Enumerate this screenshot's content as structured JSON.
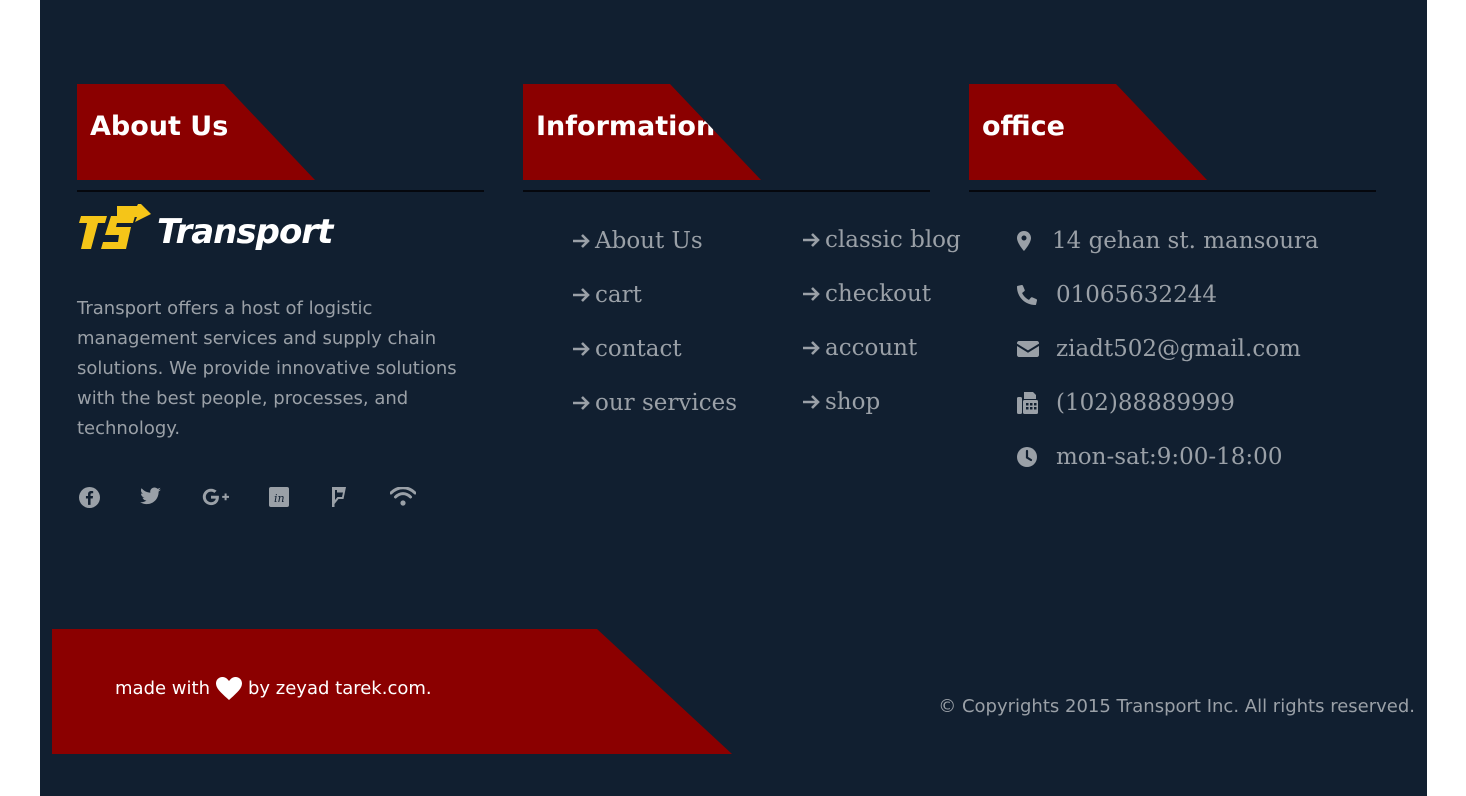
{
  "columns": {
    "about": {
      "title": "About Us"
    },
    "info": {
      "title": "Information"
    },
    "office": {
      "title": "office"
    }
  },
  "brand": {
    "name": "Transport",
    "logo_icon": "ts-arrow-logo",
    "accent": "#f5c518",
    "description": "Transport offers a host of logistic management services and supply chain solutions. We provide innovative solutions with the best people, processes, and technology."
  },
  "socials": [
    {
      "icon": "facebook-icon"
    },
    {
      "icon": "twitter-icon"
    },
    {
      "icon": "google-plus-icon"
    },
    {
      "icon": "linkedin-icon"
    },
    {
      "icon": "foursquare-icon"
    },
    {
      "icon": "rss-icon"
    }
  ],
  "links": {
    "left": [
      "About Us",
      "cart",
      "contact",
      "our services"
    ],
    "right": [
      "classic blog",
      "checkout",
      "account",
      "shop"
    ]
  },
  "office": {
    "address": "14 gehan st. mansoura",
    "phone": "01065632244",
    "email": "ziadt502@gmail.com",
    "fax": "(102)88889999",
    "hours": "mon-sat:9:00-18:00"
  },
  "bottom": {
    "made_with": "made with",
    "by": "by zeyad tarek.com.",
    "copyright": "© Copyrights 2015 Transport Inc. All rights reserved."
  },
  "colors": {
    "background": "#111f30",
    "accent_red": "#8b0000",
    "text_muted": "#9aa0a7"
  }
}
